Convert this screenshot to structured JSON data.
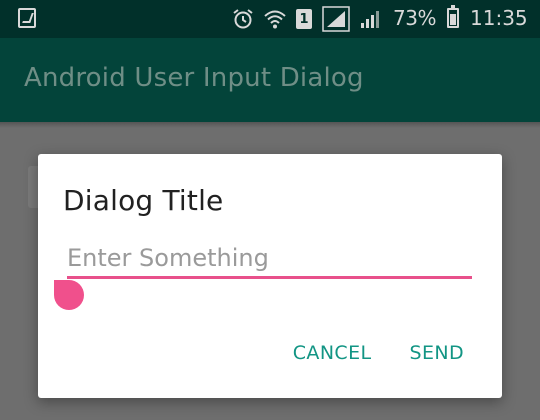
{
  "status_bar": {
    "battery_percent": "73%",
    "time": "11:35",
    "sim_slot": "1",
    "icons": [
      "screenshot-icon",
      "alarm-icon",
      "wifi-icon",
      "sim1-icon",
      "signal-icon",
      "signal-icon",
      "battery-charging-icon"
    ]
  },
  "app_bar": {
    "title": "Android User Input Dialog"
  },
  "dialog": {
    "title": "Dialog Title",
    "input_value": "",
    "input_placeholder": "Enter Something",
    "cancel_label": "CANCEL",
    "send_label": "SEND"
  },
  "colors": {
    "accent": "#e8508b",
    "button_text": "#129584",
    "primary_dark": "#01302a"
  }
}
